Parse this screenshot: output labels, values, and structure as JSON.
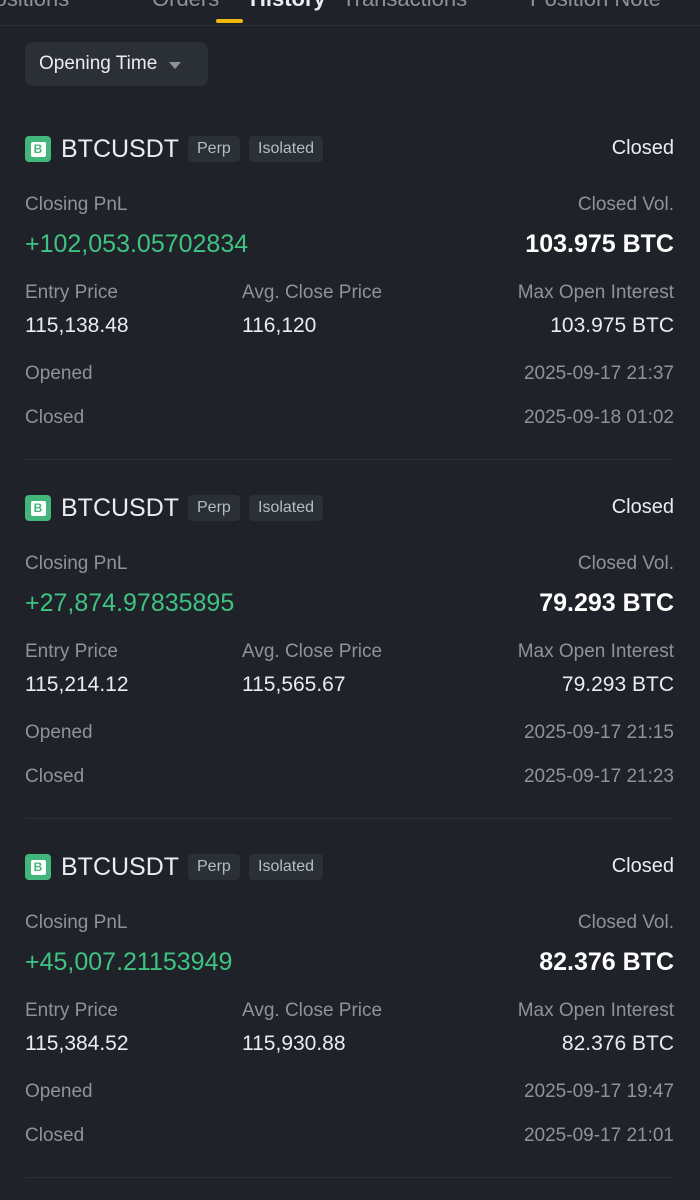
{
  "tabs": [
    {
      "label": "Positions"
    },
    {
      "label": "Orders"
    },
    {
      "label": "History"
    },
    {
      "label": "Transactions"
    },
    {
      "label": "Position Note"
    }
  ],
  "sort_button": {
    "label": "Opening Time"
  },
  "field_labels": {
    "closing_pnl": "Closing PnL",
    "closed_vol": "Closed Vol.",
    "entry_price": "Entry Price",
    "avg_close_price": "Avg. Close Price",
    "max_open_interest": "Max Open Interest",
    "opened": "Opened",
    "closed": "Closed"
  },
  "positions": [
    {
      "icon_letter": "B",
      "symbol": "BTCUSDT",
      "tag_type": "Perp",
      "tag_margin": "Isolated",
      "status": "Closed",
      "closing_pnl": "+102,053.05702834",
      "closed_vol": "103.975 BTC",
      "entry_price": "115,138.48",
      "avg_close_price": "116,120",
      "max_open_interest": "103.975 BTC",
      "opened": "2025-09-17 21:37",
      "closed": "2025-09-18 01:02"
    },
    {
      "icon_letter": "B",
      "symbol": "BTCUSDT",
      "tag_type": "Perp",
      "tag_margin": "Isolated",
      "status": "Closed",
      "closing_pnl": "+27,874.97835895",
      "closed_vol": "79.293 BTC",
      "entry_price": "115,214.12",
      "avg_close_price": "115,565.67",
      "max_open_interest": "79.293 BTC",
      "opened": "2025-09-17 21:15",
      "closed": "2025-09-17 21:23"
    },
    {
      "icon_letter": "B",
      "symbol": "BTCUSDT",
      "tag_type": "Perp",
      "tag_margin": "Isolated",
      "status": "Closed",
      "closing_pnl": "+45,007.21153949",
      "closed_vol": "82.376 BTC",
      "entry_price": "115,384.52",
      "avg_close_price": "115,930.88",
      "max_open_interest": "82.376 BTC",
      "opened": "2025-09-17 19:47",
      "closed": "2025-09-17 21:01"
    }
  ],
  "colors": {
    "background": "#1f2228",
    "profit": "#3fc383",
    "accent": "#f0b90b",
    "coin_icon": "#43b67b"
  }
}
